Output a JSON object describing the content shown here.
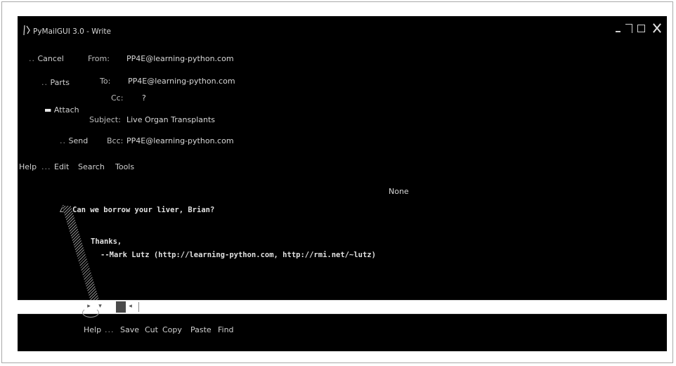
{
  "window": {
    "title": "PyMailGUI 3.0 - Write"
  },
  "toolbar": {
    "cancel": "Cancel",
    "parts": "Parts",
    "attach": "Attach",
    "send": "Send"
  },
  "headers": {
    "from_label": "From:",
    "from_value": "PP4E@learning-python.com",
    "to_label": "To:",
    "to_value": "PP4E@learning-python.com",
    "cc_label": "Cc:",
    "cc_value": "?",
    "subject_label": "Subject:",
    "subject_value": "Live Organ Transplants",
    "bcc_label": "Bcc:",
    "bcc_value": "PP4E@learning-python.com"
  },
  "menu": {
    "help": "Help",
    "edit": "Edit",
    "search": "Search",
    "tools": "Tools"
  },
  "editor": {
    "encoding": "None",
    "line1": "Can we borrow your liver, Brian?",
    "line2": "Thanks,",
    "line3": "--Mark Lutz  (http://learning-python.com, http://rmi.net/~lutz)"
  },
  "bottom_bar": {
    "help": "Help",
    "save": "Save",
    "cut": "Cut",
    "copy": "Copy",
    "paste": "Paste",
    "find": "Find"
  },
  "icons": [
    "app-icon",
    "minimize-icon",
    "maximize-icon",
    "restore-icon",
    "close-icon",
    "scroll-left-icon",
    "scroll-right-icon",
    "scroll-down-icon"
  ]
}
